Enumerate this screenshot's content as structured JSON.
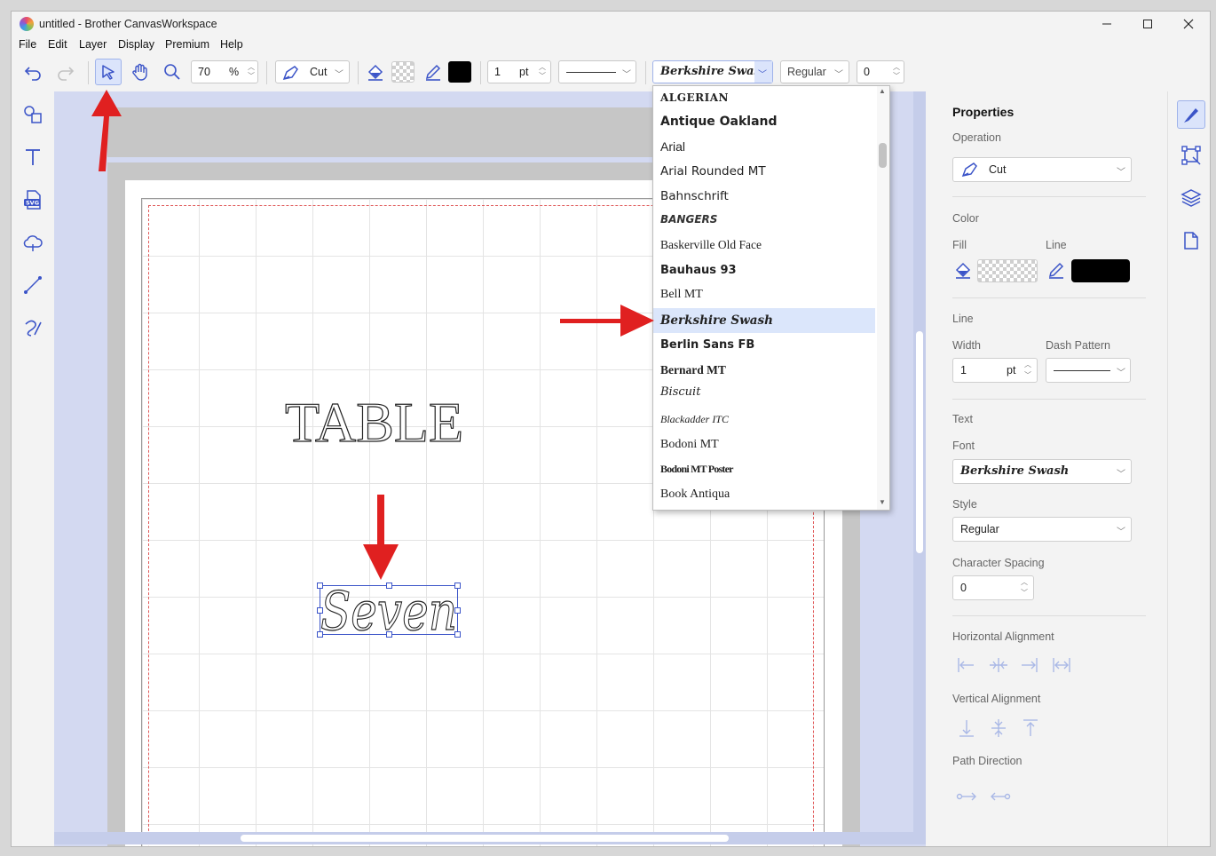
{
  "window": {
    "title": "untitled - Brother CanvasWorkspace"
  },
  "menu": [
    "File",
    "Edit",
    "Layer",
    "Display",
    "Premium",
    "Help"
  ],
  "toolbar": {
    "zoom_value": "70",
    "zoom_unit": "%",
    "operation": "Cut",
    "line_width": "1",
    "line_unit": "pt",
    "font": "Berkshire Swash",
    "style": "Regular",
    "spacing": "0"
  },
  "font_list": [
    "ALGERIAN",
    "Antique Oakland",
    "Arial",
    "Arial Rounded MT",
    "Bahnschrift",
    "BANGERS",
    "Baskerville Old Face",
    "Bauhaus 93",
    "Bell MT",
    "Berkshire Swash",
    "Berlin Sans FB",
    "Bernard MT",
    "Biscuit",
    "Blackadder ITC",
    "Bodoni MT",
    "Bodoni MT Poster",
    "Book Antiqua"
  ],
  "selected_font_index": 9,
  "canvas": {
    "text1": "TABLE",
    "text2": "Seven"
  },
  "properties": {
    "title": "Properties",
    "operation_label": "Operation",
    "operation_value": "Cut",
    "color_label": "Color",
    "fill_label": "Fill",
    "line_label": "Line",
    "line_section": "Line",
    "width_label": "Width",
    "dash_label": "Dash Pattern",
    "width_value": "1",
    "width_unit": "pt",
    "text_section": "Text",
    "font_label": "Font",
    "font_value": "Berkshire Swash",
    "style_label": "Style",
    "style_value": "Regular",
    "spacing_label": "Character Spacing",
    "spacing_value": "0",
    "halign_label": "Horizontal Alignment",
    "valign_label": "Vertical Alignment",
    "path_label": "Path Direction"
  },
  "colors": {
    "accent": "#3b54c8",
    "canvas_bg": "#d3d9f1",
    "selection": "#dbe6fb",
    "arrow": "#e02020"
  }
}
